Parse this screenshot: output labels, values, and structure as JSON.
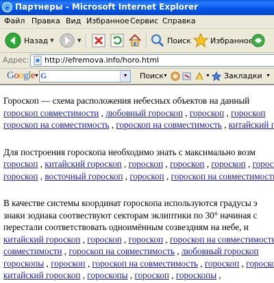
{
  "window": {
    "title": "Партнеры - Microsoft Internet Explorer"
  },
  "menu": [
    "Файл",
    "Правка",
    "Вид",
    "Избранное",
    "Сервис",
    "Справка"
  ],
  "toolbar": {
    "back": "Назад",
    "search": "Поиск",
    "favorites": "Избранное"
  },
  "address": {
    "label": "Адрес:",
    "url": "http://efremova.info/horo.html"
  },
  "google": {
    "search_label": "Поиск",
    "bookmarks_label": "Закладки"
  },
  "content": {
    "p1": {
      "text": "Гороскоп — схема расположения небесных объектов на данный",
      "line1": [
        "гороскоп совместимости",
        "любовный гороскоп",
        "гороскоп",
        "гороскоп"
      ],
      "line2": [
        "гороскоп на совместимость",
        "гороскоп на совместимость",
        "китайский гороскоп"
      ]
    },
    "p2": {
      "text": "Для построения гороскопа необходимо знать с максимально возм",
      "line1": [
        "гороскоп",
        "китайский гороскоп",
        "гороскоп",
        "гороскоп",
        "гороскоп",
        "гороскоп"
      ],
      "line2": [
        "гороскоп",
        "восточный гороскоп",
        "гороскоп",
        "гороскоп на совместимость"
      ]
    },
    "p3": {
      "t1": "В качестве системы координат гороскопа используются градусы э",
      "t2": "знаки зодиака соотвествуют секторам эклиптики по 30° начиная с",
      "t3": "перестали соответствовать одноимённым созвездиям на небе, и",
      "line1": [
        "китайский гороскоп",
        "гороскоп",
        "гороскоп",
        "гороскоп на совместимость"
      ],
      "line2": [
        "совместимости",
        "гороскоп на совместимость",
        "любовный гороскоп"
      ],
      "line3": [
        "гороскопы",
        "гороскоп",
        "гороскоп на совместимость",
        "гороскоп",
        "гороскоп"
      ],
      "line4": [
        "китайский гороскоп",
        "гороскопы",
        "гороскоп",
        "гороскопы"
      ]
    }
  }
}
